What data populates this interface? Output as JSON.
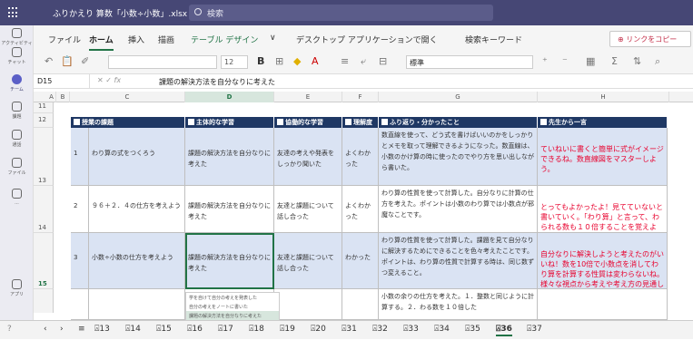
{
  "titlebar": {
    "title": "ふりかえり 算数「小数÷小数」.xlsx",
    "search_placeholder": "検索"
  },
  "rail": [
    {
      "label": "アクティビティ",
      "icon": "bell-icon"
    },
    {
      "label": "チャット",
      "icon": "chat-icon"
    },
    {
      "label": "チーム",
      "icon": "teams-icon",
      "active": true
    },
    {
      "label": "課題",
      "icon": "assignments-icon"
    },
    {
      "label": "通話",
      "icon": "phone-icon"
    },
    {
      "label": "ファイル",
      "icon": "files-icon"
    },
    {
      "label": "...",
      "icon": "more-icon"
    },
    {
      "label": "アプリ",
      "icon": "apps-icon"
    },
    {
      "label": "?",
      "icon": "help-icon"
    }
  ],
  "menu": [
    "ファイル",
    "ホーム",
    "挿入",
    "描画",
    "テーブル デザイン",
    "∨",
    "デスクトップ アプリケーションで開く",
    "検索キーワード"
  ],
  "link_button": "リンクをコピー",
  "toolbar": {
    "font_size": "12",
    "number_format": "標準"
  },
  "formula": {
    "namebox": "D15",
    "fx": "fx",
    "value": "課題の解決方法を自分なりに考えた"
  },
  "columns": [
    "A",
    "B",
    "C",
    "D",
    "E",
    "F",
    "G",
    "H"
  ],
  "row_numbers": [
    "11",
    "12",
    "13",
    "14",
    "15"
  ],
  "headers": [
    "授業の課題",
    "主体的な学習",
    "協働的な学習",
    "理解度",
    "ふり返り・分かったこと",
    "先生から一言"
  ],
  "rows": [
    {
      "no": "1",
      "task": "わり算の式をつくろう",
      "active": "課題の解決方法を自分なりに考えた",
      "collab": "友達の考えや発表をしっかり聞いた",
      "understand": "よくわかった",
      "reflect": "数直線を使って、どう式を書けばいいのかをしっかりとメモを取って理解できるようになった。数直線は、小数のかけ算の時に使ったのでやり方を思い出しながら書いた。",
      "teacher": "ていねいに書くと簡単に式がイメージできるね。数直線図をマスターしよう。"
    },
    {
      "no": "2",
      "task": "９６＋２．４の仕方を考えよう",
      "active": "課題の解決方法を自分なりに考えた",
      "collab": "友達と課題について話し合った",
      "understand": "よくわかった",
      "reflect": "わり算の性質を使って計算した。自分なりに計算の仕方を考えた。ポイントは小数のわり算では小数点が邪魔なことです。",
      "teacher": "とってもよかったよ！見てていないと書いていく。「わり算」と言って、わられる数も１０倍することを覚えよう。"
    },
    {
      "no": "3",
      "task": "小数÷小数の仕方を考えよう",
      "active": "課題の解決方法を自分なりに考えた",
      "collab": "友達と課題について話し合った",
      "understand": "わかった",
      "reflect": "わり算の性質を使って計算した。課題を見て自分なりに解決するためにできることを色々考えたことです。ポイントは、わり算の性質で計算する時は、同じ数ずつ変えること。",
      "teacher": "自分なりに解決しようと考えたのがいいね！数を10倍で小数点を消してわり算を計算する性質は変わらないね。様々な視点から考えや考え方の見通しがもてるといいね！"
    },
    {
      "no": "",
      "task": "",
      "active": "",
      "collab": "",
      "understand": "",
      "reflect": "小数の余りの仕方を考えた。１．整数と同じように計算する。２．わる数を１０倍した",
      "teacher": ""
    }
  ],
  "dropdown": [
    "学を自けて自分の考えを発表した",
    "自分の考えをノートに書いた",
    "課題の解決方法を自分なりに考えた"
  ],
  "sheet_tabs": [
    "13",
    "14",
    "15",
    "16",
    "17",
    "18",
    "19",
    "20",
    "31",
    "32",
    "33",
    "34",
    "35",
    "36",
    "37"
  ],
  "active_tab": "36",
  "colors": {
    "teams": "#464775",
    "excel_green": "#217346",
    "table_header": "#1f3864",
    "band": "#dae3f3",
    "teacher_text": "#e8002d"
  }
}
